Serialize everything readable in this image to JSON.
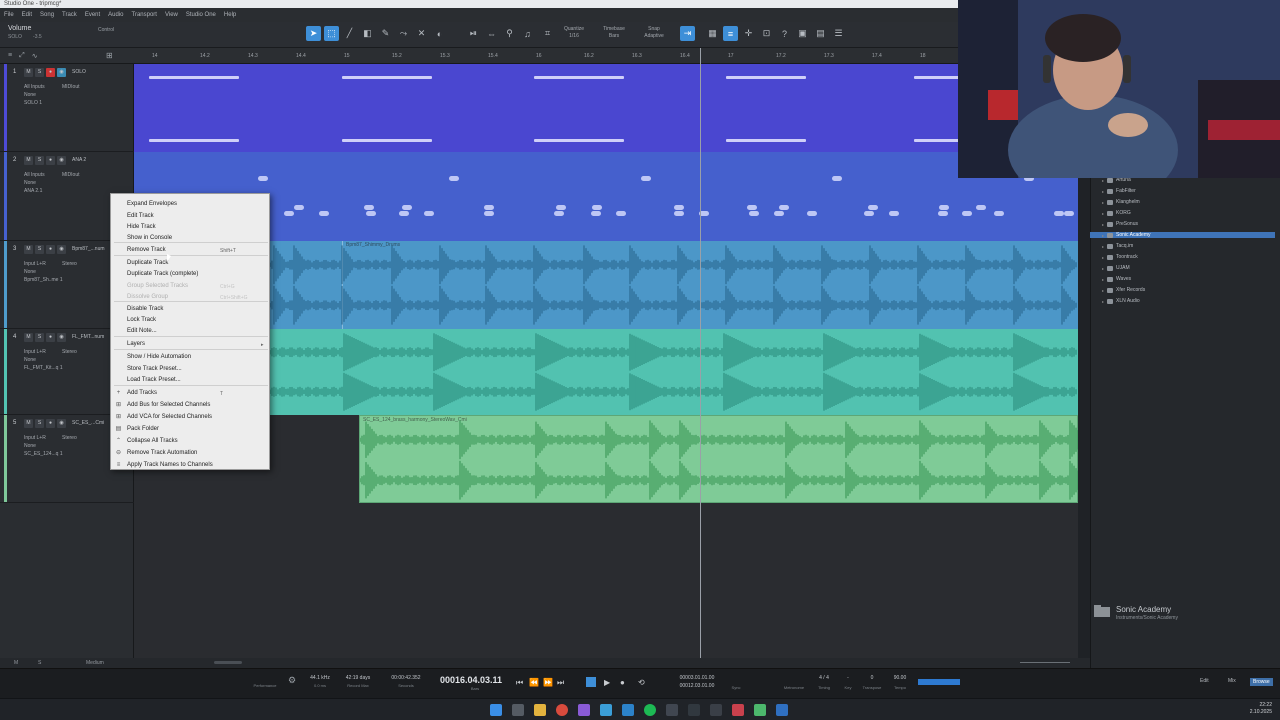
{
  "window": {
    "title": "Studio One - tripmcg*"
  },
  "menu": [
    "File",
    "Edit",
    "Song",
    "Track",
    "Event",
    "Audio",
    "Transport",
    "View",
    "Studio One",
    "Help"
  ],
  "inspector": {
    "title": "Volume",
    "channel": "SOLO",
    "value": "-3.5",
    "control": "Control"
  },
  "toolbar": {
    "quantize_label": "Quantize",
    "quantize_value": "1/16",
    "timebase_label": "Timebase",
    "timebase_value": "Bars",
    "snap_label": "Snap",
    "snap_value": "Adaptive"
  },
  "ruler": [
    "14",
    "14.2",
    "14.3",
    "14.4",
    "15",
    "15.2",
    "15.3",
    "15.4",
    "16",
    "16.2",
    "16.3",
    "16.4",
    "17",
    "17.2",
    "17.3",
    "17.4",
    "18"
  ],
  "tracks": [
    {
      "num": "1",
      "name": "SOLO",
      "in": "All Inputs",
      "out": "MIDIout",
      "ch": "None",
      "sub": "SOLO 1",
      "color": "#4e4bd6"
    },
    {
      "num": "2",
      "name": "ANA 2",
      "in": "All Inputs",
      "out": "MIDIout",
      "ch": "None",
      "sub": "ANA 2.1",
      "color": "#4661d0"
    },
    {
      "num": "3",
      "name": "Bpm87_...num",
      "in": "Input L+R",
      "out": "Stereo",
      "ch": "None",
      "sub": "Bpm87_Sh..me 1",
      "color": "#4f9ccc"
    },
    {
      "num": "4",
      "name": "FL_FMT...num",
      "in": "Input L+R",
      "out": "Stereo",
      "ch": "None",
      "sub": "FL_FMT_Kit...q 1",
      "color": "#53c4b3"
    },
    {
      "num": "5",
      "name": "SC_ES_...Cmi",
      "in": "Input L+R",
      "out": "Stereo",
      "ch": "None",
      "sub": "SC_ES_124...q 1",
      "color": "#7fc89a"
    }
  ],
  "clips": {
    "drums": "Bpm87_Shimmy_Drums",
    "harmony": "SC_ES_124_brass_harmony_StereoWav_Cmi"
  },
  "context_menu": {
    "items": [
      {
        "label": "Expand Envelopes",
        "shortcut": "",
        "enabled": true
      },
      {
        "label": "Edit Track",
        "shortcut": "",
        "enabled": true
      },
      {
        "label": "Hide Track",
        "shortcut": "",
        "enabled": true
      },
      {
        "label": "Show in Console",
        "shortcut": "",
        "enabled": true
      },
      {
        "label": "Remove Track",
        "shortcut": "Shift+T",
        "enabled": true
      },
      {
        "label": "Duplicate Track",
        "shortcut": "",
        "enabled": true
      },
      {
        "label": "Duplicate Track (complete)",
        "shortcut": "",
        "enabled": true
      },
      {
        "label": "Group Selected Tracks",
        "shortcut": "Ctrl+G",
        "enabled": false
      },
      {
        "label": "Dissolve Group",
        "shortcut": "Ctrl+Shift+G",
        "enabled": false
      },
      {
        "label": "Disable Track",
        "shortcut": "",
        "enabled": true
      },
      {
        "label": "Lock Track",
        "shortcut": "",
        "enabled": true
      },
      {
        "label": "Edit Note...",
        "shortcut": "",
        "enabled": true
      },
      {
        "label": "Layers",
        "shortcut": "▸",
        "enabled": true
      },
      {
        "label": "Show / Hide Automation",
        "shortcut": "",
        "enabled": true
      },
      {
        "label": "Store Track Preset...",
        "shortcut": "",
        "enabled": true
      },
      {
        "label": "Load Track Preset...",
        "shortcut": "",
        "enabled": true
      },
      {
        "label": "Add Tracks",
        "shortcut": "T",
        "enabled": true
      },
      {
        "label": "Add Bus for Selected Channels",
        "shortcut": "",
        "enabled": true
      },
      {
        "label": "Add VCA for Selected Channels",
        "shortcut": "",
        "enabled": true
      },
      {
        "label": "Pack Folder",
        "shortcut": "",
        "enabled": true
      },
      {
        "label": "Collapse All Tracks",
        "shortcut": "",
        "enabled": true
      },
      {
        "label": "Remove Track Automation",
        "shortcut": "",
        "enabled": true
      },
      {
        "label": "Apply Track Names to Channels",
        "shortcut": "",
        "enabled": true
      }
    ]
  },
  "browser": {
    "items": [
      "Arturia",
      "FabFilter",
      "Klanghelm",
      "KORG",
      "PreSonus",
      "Sonic Academy",
      "Tacq.im",
      "Toontrack",
      "UJAM",
      "Waves",
      "Xfer Records",
      "XLN Audio"
    ],
    "selected": "Sonic Academy",
    "pack_name": "Sonic Academy",
    "pack_path": "Instruments/Sonic Academy"
  },
  "bottom_nav": {
    "zoom": "Medium"
  },
  "transport": {
    "sample_rate": "44.1 kHz",
    "latency": "0.0 ms",
    "perf_label": "Performance",
    "record_max": "42:19 days",
    "record_max_label": "Record Max",
    "seconds": "00:00:42.352",
    "seconds_label": "Seconds",
    "position": "00016.04.03.11",
    "position_label": "Bars",
    "loop_start": "00003.01.01.00",
    "loop_end": "00012.03.01.00",
    "sync_label": "Sync",
    "metronome_label": "Metronome",
    "timing": "4 / 4",
    "timing_label": "Timing",
    "key": "-",
    "key_label": "Key",
    "transpose": "0",
    "transpose_label": "Transpose",
    "tempo": "90.00",
    "tempo_label": "Tempo",
    "tab_edit": "Edit",
    "tab_mix": "Mix",
    "tab_browse": "Browse"
  },
  "taskbar": {
    "time": "22:22",
    "date": "2.10.2025"
  }
}
